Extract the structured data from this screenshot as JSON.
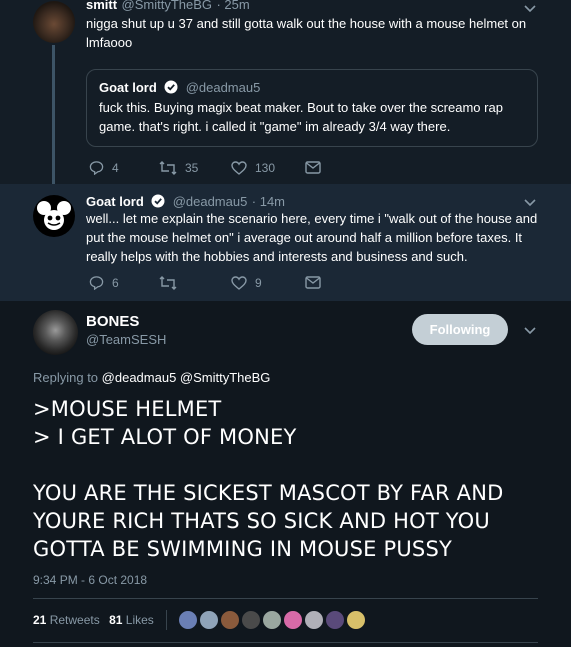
{
  "tweet1": {
    "name": "smitt",
    "handle": "@SmittyTheBG",
    "time": "· 25m",
    "text_line1": "nigga shut up u 37 and still gotta walk out the house with a mouse helmet on",
    "text_line2": "lmfaooo",
    "quote": {
      "name": "Goat lord",
      "handle": "@deadmau5",
      "text_line1": "fuck this.  Buying magix beat maker. Bout to take over the screamo rap",
      "text_line2": "game.  that's right. i called it \"game\" im already 3/4 way there."
    },
    "replies": "4",
    "retweets": "35",
    "likes": "130"
  },
  "tweet2": {
    "name": "Goat lord",
    "handle": "@deadmau5",
    "time": "· 14m",
    "text_line1": "well... let me explain the scenario here, every time i \"walk out of the house and",
    "text_line2": "put the mouse helmet on\"  i average out around half a million before taxes. It",
    "text_line3": "really helps with the hobbies and interests and business and such.",
    "replies": "6",
    "retweets": "",
    "likes": "9"
  },
  "main": {
    "name": "BONES",
    "handle": "@TeamSESH",
    "follow_label": "Following",
    "replying_prefix": "Replying to",
    "replying_to": "@deadmau5 @SmittyTheBG",
    "line1": ">MOUSE HELMET",
    "line2": "> I GET ALOT OF MONEY",
    "line3": "YOU ARE THE SICKEST MASCOT BY FAR AND",
    "line4": "YOURE RICH THATS SO SICK AND HOT YOU",
    "line5": "GOTTA BE SWIMMING IN MOUSE PUSSY",
    "timestamp": "9:34 PM - 6 Oct 2018",
    "retweets_count": "21",
    "retweets_label": "Retweets",
    "likes_count": "81",
    "likes_label": "Likes"
  },
  "colors": {
    "background": "#141d26",
    "highlight": "#1b2836",
    "muted": "#8899a6",
    "verified": "#1da1f2",
    "follow_button": "#c4cfd6"
  }
}
